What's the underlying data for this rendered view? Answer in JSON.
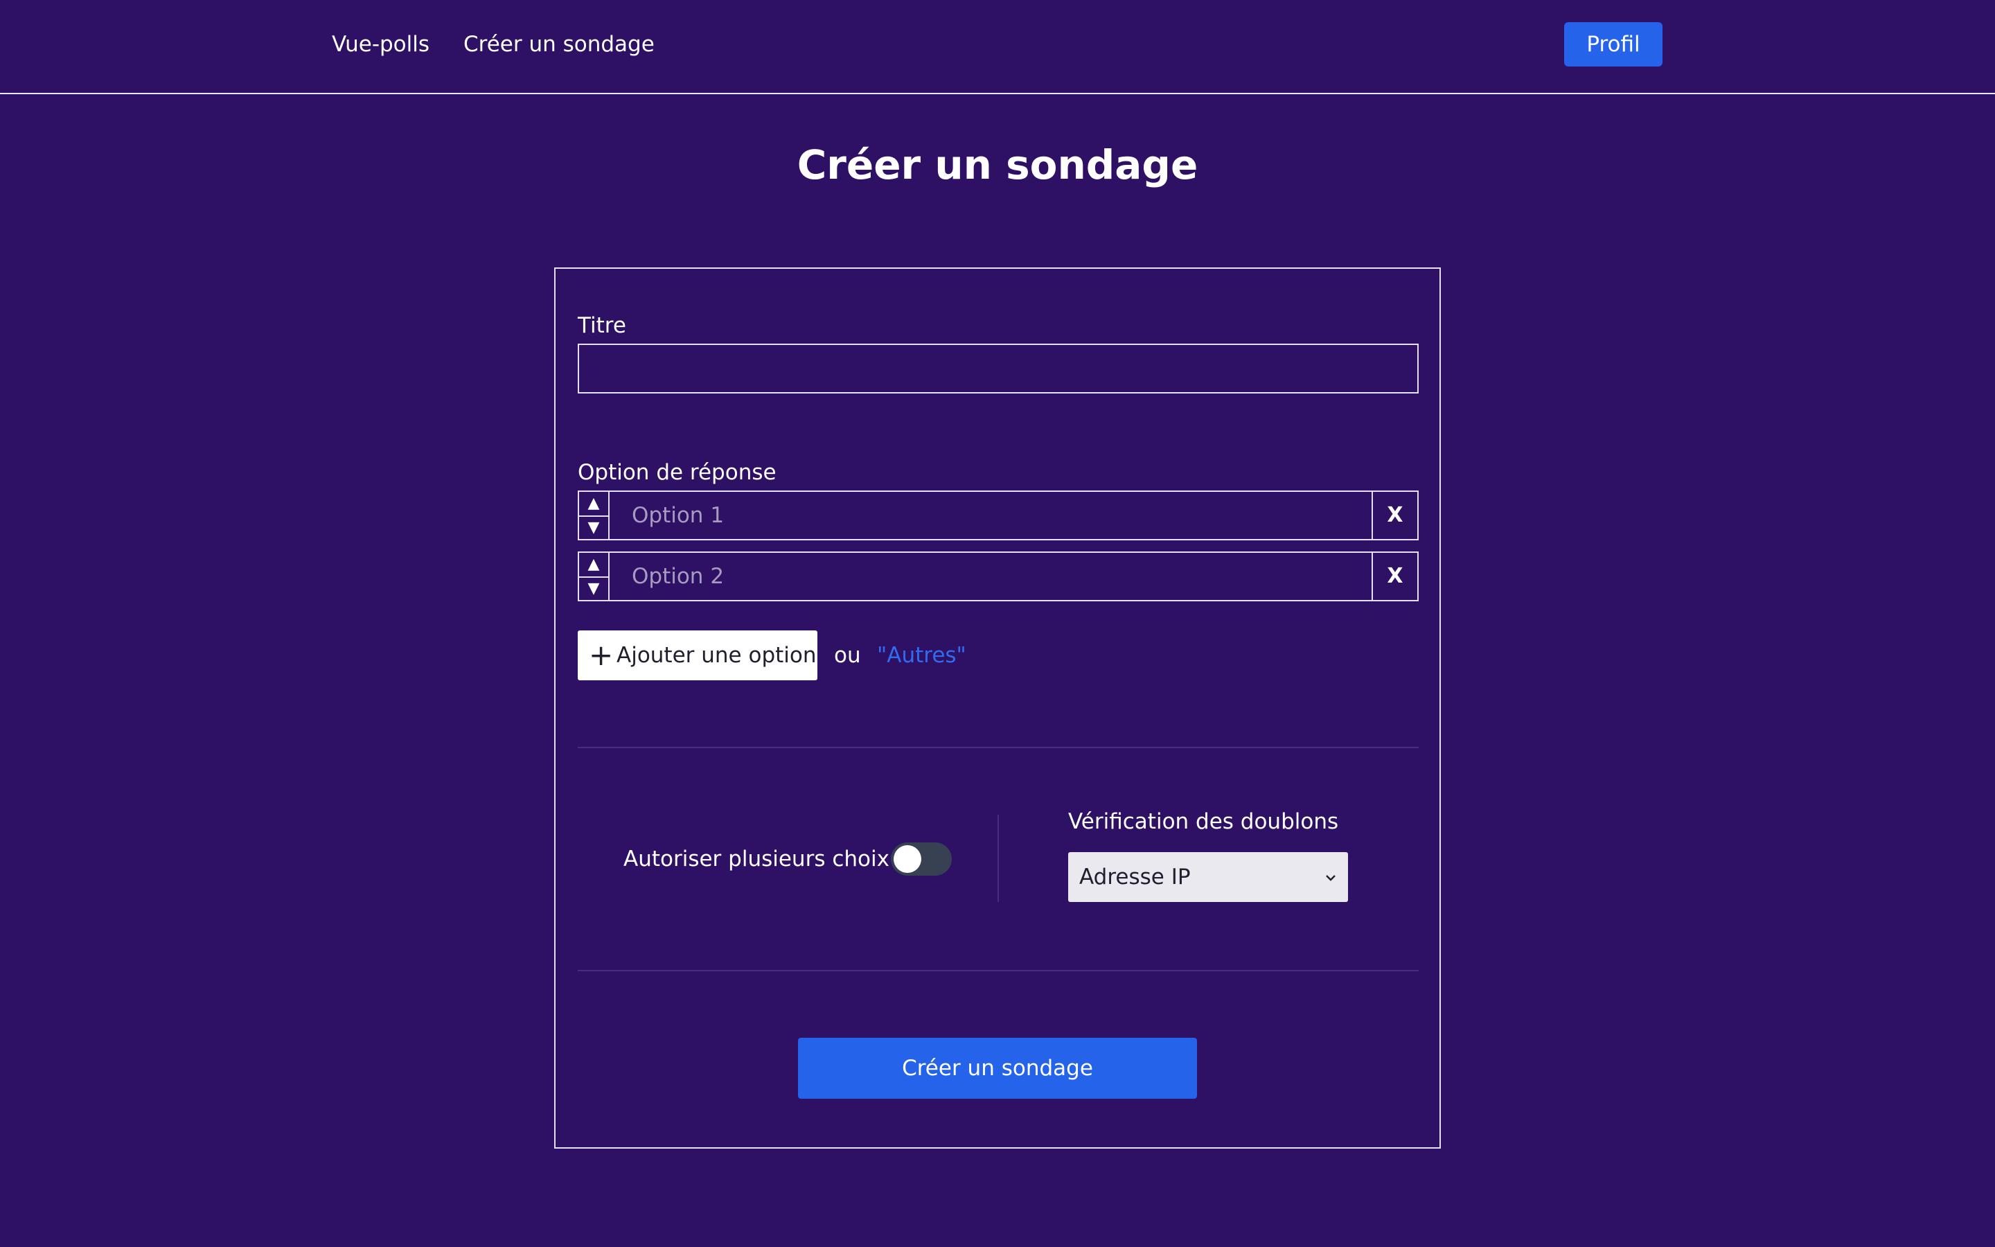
{
  "navbar": {
    "brand": "Vue-polls",
    "create_link": "Créer un sondage",
    "profile_button": "Profil"
  },
  "page": {
    "title": "Créer un sondage"
  },
  "form": {
    "title_label": "Titre",
    "title_value": "",
    "options_label": "Option de réponse",
    "options": [
      {
        "placeholder": "Option 1",
        "value": "",
        "up": "▲",
        "down": "▼",
        "remove": "X"
      },
      {
        "placeholder": "Option 2",
        "value": "",
        "up": "▲",
        "down": "▼",
        "remove": "X"
      }
    ],
    "add_option_label": "Ajouter une option",
    "or_text": "ou",
    "others_link": "\"Autres\"",
    "multiple_choice_label": "Autoriser plusieurs choix",
    "multiple_choice_enabled": false,
    "duplicate_check_label": "Vérification des doublons",
    "duplicate_check_value": "Adresse IP",
    "submit_label": "Créer un sondage"
  },
  "colors": {
    "background": "#2e1065",
    "accent": "#2563eb",
    "link": "#2f6cf0",
    "toggle_off": "#374151"
  }
}
